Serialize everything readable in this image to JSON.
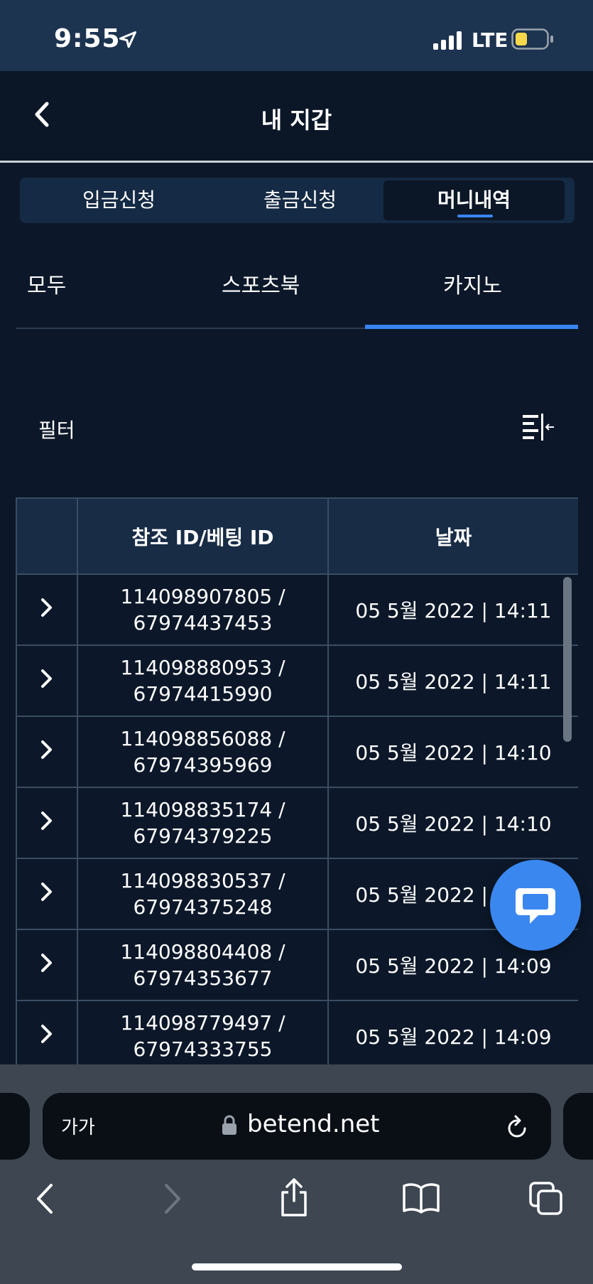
{
  "status_bar": {
    "time": "9:55",
    "network": "LTE",
    "battery_color": "#f5d94a"
  },
  "header": {
    "title": "내 지갑"
  },
  "main_tabs": [
    {
      "label": "입금신청",
      "active": false
    },
    {
      "label": "출금신청",
      "active": false
    },
    {
      "label": "머니내역",
      "active": true
    }
  ],
  "sub_tabs": [
    {
      "label": "모두",
      "active": false
    },
    {
      "label": "스포츠북",
      "active": false
    },
    {
      "label": "카지노",
      "active": true
    }
  ],
  "filter": {
    "label": "필터"
  },
  "table": {
    "columns": [
      "",
      "참조 ID/베팅 ID",
      "날짜"
    ],
    "rows": [
      {
        "ref_id": "114098907805 /",
        "bet_id": "67974437453",
        "date": "05 5월 2022 | 14:11"
      },
      {
        "ref_id": "114098880953 /",
        "bet_id": "67974415990",
        "date": "05 5월 2022 | 14:11"
      },
      {
        "ref_id": "114098856088 /",
        "bet_id": "67974395969",
        "date": "05 5월 2022 | 14:10"
      },
      {
        "ref_id": "114098835174 /",
        "bet_id": "67974379225",
        "date": "05 5월 2022 | 14:10"
      },
      {
        "ref_id": "114098830537 /",
        "bet_id": "67974375248",
        "date": "05 5월 2022 | 14:10"
      },
      {
        "ref_id": "114098804408 /",
        "bet_id": "67974353677",
        "date": "05 5월 2022 | 14:09"
      },
      {
        "ref_id": "114098779497 /",
        "bet_id": "67974333755",
        "date": "05 5월 2022 | 14:09"
      }
    ]
  },
  "browser": {
    "text_size_label": "가가",
    "url": "betend.net"
  },
  "colors": {
    "accent": "#3a84f2",
    "background": "#0c1829",
    "header_row": "#182c46"
  }
}
